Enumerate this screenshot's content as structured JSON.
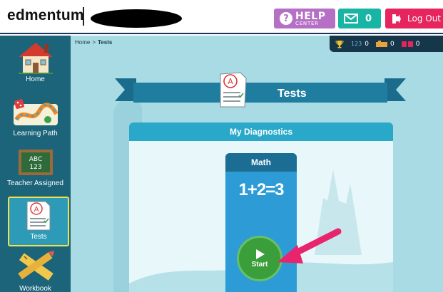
{
  "brand": {
    "logo": "edmentum"
  },
  "header": {
    "help": {
      "label": "HELP",
      "sublabel": "CENTER"
    },
    "messages": {
      "count": "0"
    },
    "logout": {
      "label": "Log Out"
    }
  },
  "sidebar": {
    "items": [
      {
        "label": "Home",
        "icon": "house-icon",
        "active": false
      },
      {
        "label": "Learning Path",
        "icon": "game-board-icon",
        "active": false
      },
      {
        "label": "Teacher Assigned",
        "icon": "chalkboard-icon",
        "board_text_1": "ABC",
        "board_text_2": "123",
        "active": false
      },
      {
        "label": "Tests",
        "icon": "test-paper-icon",
        "active": true
      },
      {
        "label": "Workbook",
        "icon": "pencil-ruler-icon",
        "active": false
      }
    ]
  },
  "breadcrumb": {
    "home": "Home",
    "separator": ">",
    "current": "Tests"
  },
  "stats": {
    "trophies": "",
    "values": [
      "0",
      "0",
      "0"
    ],
    "first_icon_text": "123"
  },
  "page": {
    "title": "Tests"
  },
  "diagnostics": {
    "title": "My Diagnostics",
    "card": {
      "subject": "Math",
      "equation": "1+2=3",
      "start_label": "Start"
    }
  },
  "colors": {
    "sidebar": "#1c647a",
    "main_bg": "#a8dbe4",
    "help": "#b56fc4",
    "messages": "#19b5a4",
    "logout": "#e6245d",
    "ribbon": "#1f7da0",
    "diag_header": "#2aa8c9",
    "math_card": "#2d9cd6",
    "start": "#3a9e3a",
    "arrow": "#e8246d"
  }
}
